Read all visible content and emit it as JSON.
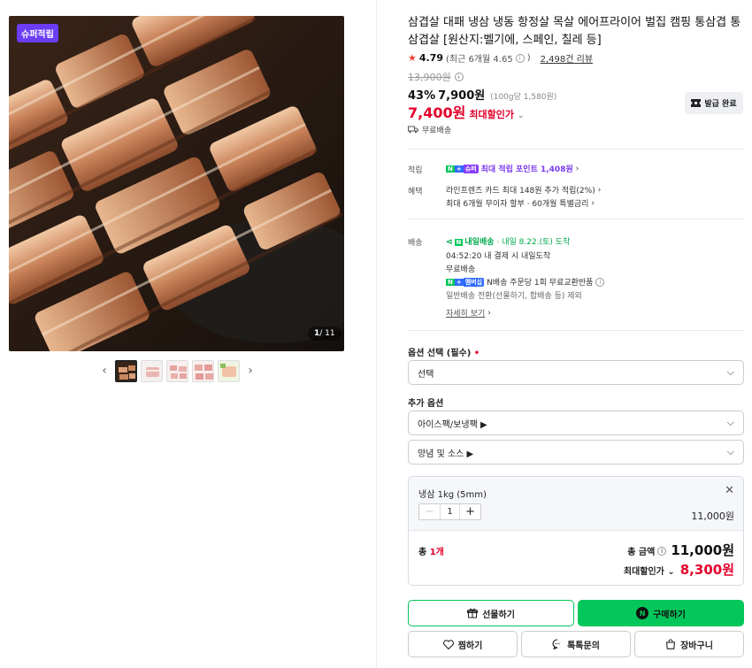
{
  "gallery": {
    "badge": "슈퍼적립",
    "counter_current": "1",
    "counter_total": "/ 11",
    "thumbnail_count": 5
  },
  "product": {
    "title": "삼겹살 대패 냉삼 냉동 항정살 목살 에어프라이어 벌집 캠핑 통삼겹 통삼겹살 [원산지:벨기에, 스페인, 칠레 등]",
    "rating": "4.79",
    "rating_recent": "(최근 6개월 4.65",
    "rating_recent_close": ")",
    "review_count": "2,498건 리뷰",
    "original_price": "13,900원",
    "discount_rate": "43%",
    "sale_price": "7,900원",
    "unit_price": "(100g당 1,580원)",
    "max_discount_price": "7,400원",
    "max_discount_label": "최대할인가",
    "coupon_button": "발급 완료",
    "shipping_free": "무료배송"
  },
  "benefits": {
    "points_label": "적립",
    "points_text": "최대 적립 포인트 1,408원",
    "perks_label": "혜택",
    "perk_1": "라인프렌즈 카드 최대 148원 추가 적립(2%)",
    "perk_2": "최대 6개월 무이자 할부 · 60개월 특별금리",
    "delivery_label": "배송",
    "delivery_badge": "내일배송",
    "delivery_date": "· 내일 8.22.(토) 도착",
    "delivery_cutoff": "04:52:20 내 결제 시 내일도착",
    "delivery_free": "무료배송",
    "delivery_return": "N배송 주문당 1회 무료교환반품",
    "delivery_exclude": "일반배송 전환(선물하기, 합배송 등) 제외",
    "delivery_more": "자세히 보기"
  },
  "options": {
    "required_label": "옵션 선택 (필수)",
    "required_mark": "•",
    "select_placeholder": "선택",
    "extra_label": "추가 옵션",
    "extra_1": "아이스팩/보냉팩 ▶",
    "extra_2": "양념 및 소스 ▶"
  },
  "selected": {
    "name": "냉삼 1kg (5mm)",
    "quantity": "1",
    "price": "11,000원",
    "total_label": "총",
    "total_count": "1개",
    "total_amount_label": "총 금액",
    "total_amount": "11,000원",
    "max_total_label": "최대할인가",
    "max_total": "8,300원"
  },
  "actions": {
    "gift": "선물하기",
    "buy": "구매하기",
    "wish": "찜하기",
    "talk": "톡톡문의",
    "cart": "장바구니"
  },
  "colors": {
    "accent_red": "#e4002b",
    "naver_green": "#03c75a",
    "point_purple": "#7a3af0"
  }
}
